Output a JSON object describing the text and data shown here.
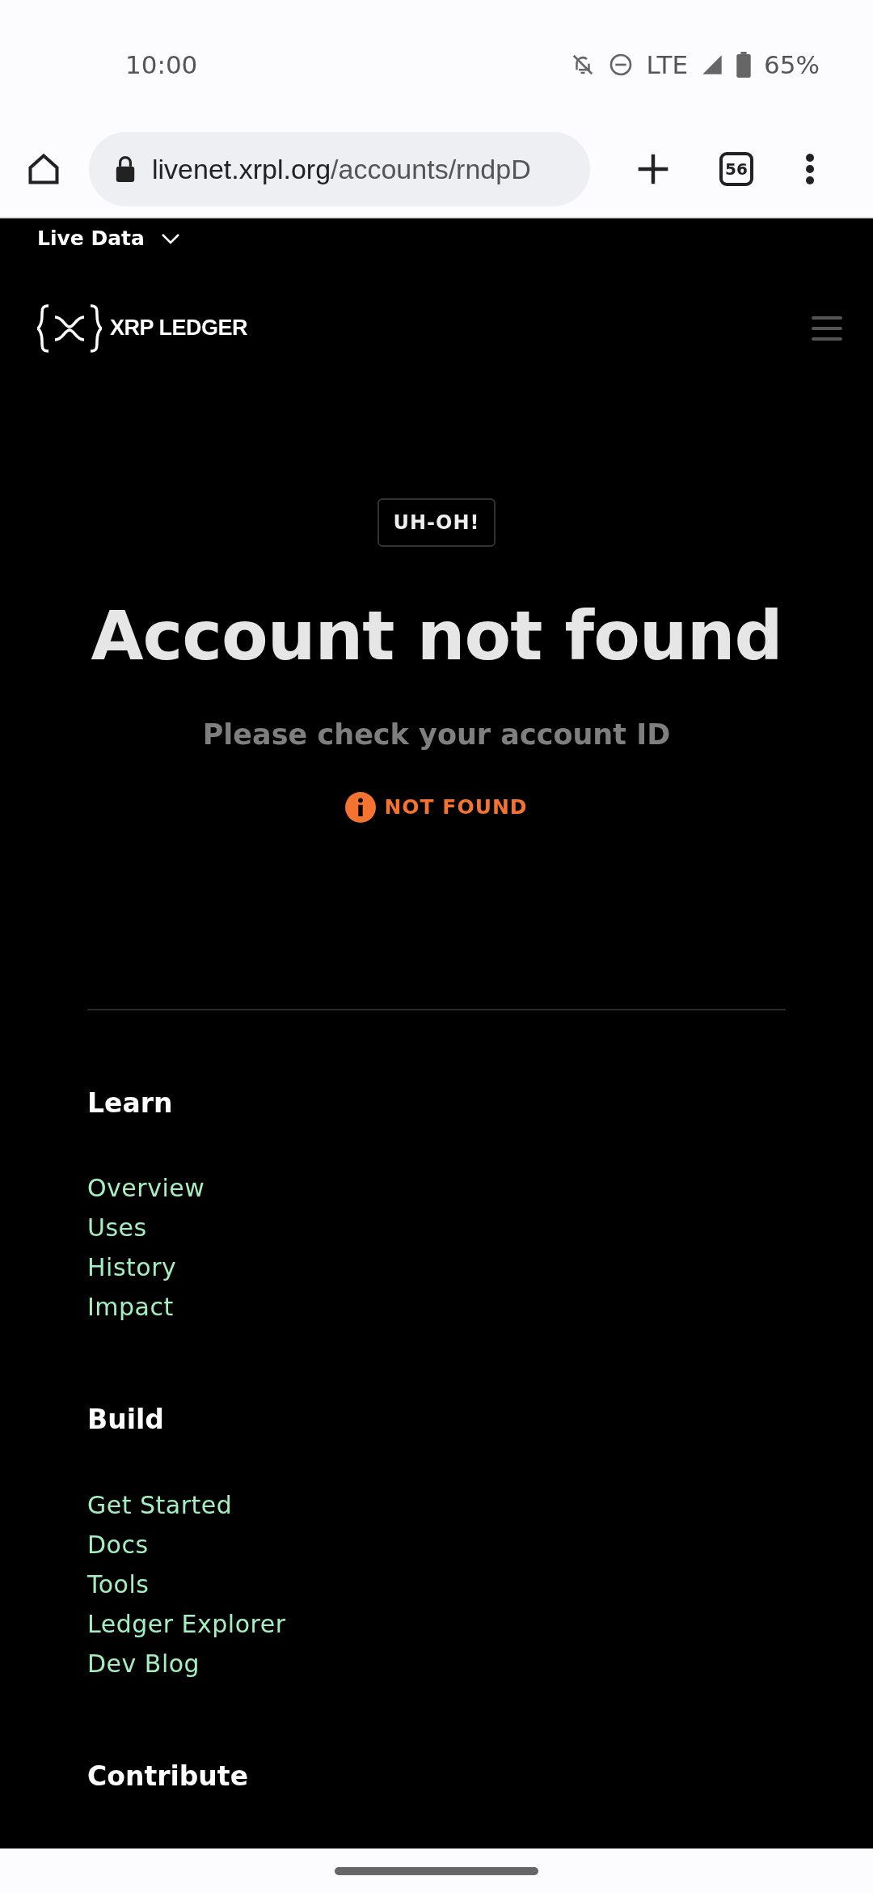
{
  "status_bar": {
    "time": "10:00",
    "network": "LTE",
    "battery": "65%"
  },
  "browser": {
    "url_host": "livenet.xrpl.org",
    "url_path": "/accounts/rndpD",
    "tab_count": "56"
  },
  "top_bar": {
    "network_selector": "Live Data"
  },
  "header": {
    "logo_text": "XRP LEDGER"
  },
  "error": {
    "badge": "UH-OH!",
    "title": "Account not found",
    "subtitle": "Please check your account ID",
    "status": "NOT FOUND"
  },
  "footer": {
    "sections": [
      {
        "title": "Learn",
        "links": [
          "Overview",
          "Uses",
          "History",
          "Impact"
        ]
      },
      {
        "title": "Build",
        "links": [
          "Get Started",
          "Docs",
          "Tools",
          "Ledger Explorer",
          "Dev Blog"
        ]
      },
      {
        "title": "Contribute"
      }
    ]
  }
}
